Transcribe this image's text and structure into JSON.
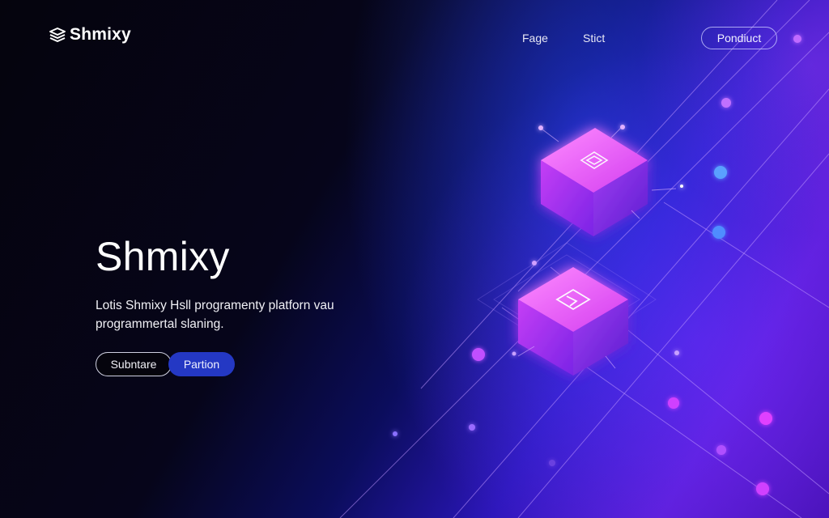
{
  "brand": {
    "name": "Shmixy",
    "logo_icon": "layers-icon"
  },
  "nav": {
    "items": [
      "Fage",
      "Stict"
    ],
    "cta_label": "Pondiuct"
  },
  "hero": {
    "title": "Shmixy",
    "subtitle_line1": "Lotis Shmixy Hsll programenty platforn vau",
    "subtitle_line2": "programmertal slaning.",
    "primary_button": "Subntare",
    "secondary_button": "Partion"
  },
  "colors": {
    "background": "#05040d",
    "accent_blue": "#2438c4",
    "accent_purple": "#6a22e0",
    "cube_pink": "#e040ff"
  }
}
